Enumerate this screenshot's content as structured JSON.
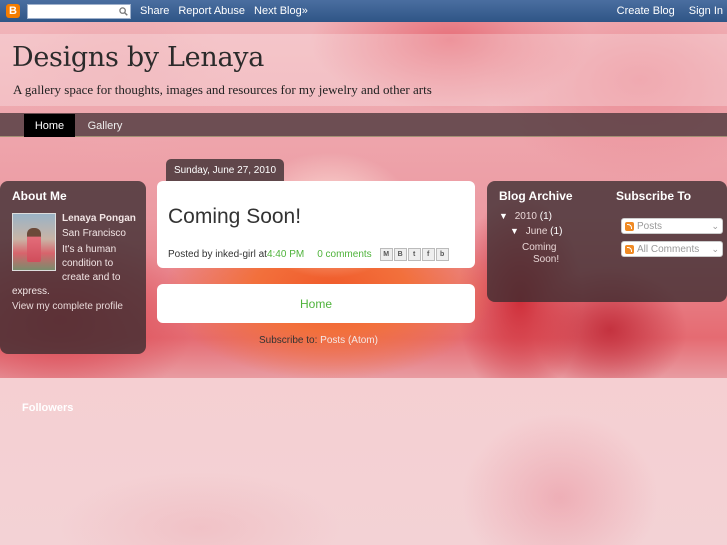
{
  "navbar": {
    "logo": "B",
    "search": {
      "placeholder": ""
    },
    "links": [
      "Share",
      "Report Abuse",
      "Next Blog»"
    ],
    "right_links": [
      "Create Blog",
      "Sign In"
    ]
  },
  "header": {
    "title": "Designs by Lenaya",
    "description": "A gallery space for thoughts, images and resources for my jewelry and other arts"
  },
  "tabs": [
    {
      "label": "Home",
      "active": true
    },
    {
      "label": "Gallery",
      "active": false
    }
  ],
  "about": {
    "title": "About Me",
    "name": "Lenaya Pongan",
    "location": "San Francisco",
    "bio": "It's a human condition to create and to express.",
    "profile_link": "View my complete profile"
  },
  "post": {
    "date": "Sunday, June 27, 2010",
    "title": "Coming Soon!",
    "posted_by": "Posted by inked-girl at ",
    "time": "4:40 PM",
    "comments": "0 comments",
    "share_icons": [
      "email-icon",
      "blogthis-icon",
      "twitter-icon",
      "facebook-icon",
      "buzz-icon"
    ]
  },
  "pager": {
    "home": "Home"
  },
  "subscribe_line": {
    "label": "Subscribe to: ",
    "link": "Posts (Atom)"
  },
  "archive": {
    "title": "Blog Archive",
    "year": "2010",
    "year_count": "(1)",
    "month": "June",
    "month_count": "(1)",
    "post_link_line1": "Coming",
    "post_link_line2": "Soon!"
  },
  "subscribe": {
    "title": "Subscribe To",
    "posts": "Posts",
    "comments": "All Comments"
  },
  "followers": {
    "title": "Followers"
  },
  "colors": {
    "navbar": "#2f5586",
    "accent_link": "#4fb33b",
    "panel": "#3a2c30",
    "blogger_logo": "#f57d00"
  }
}
